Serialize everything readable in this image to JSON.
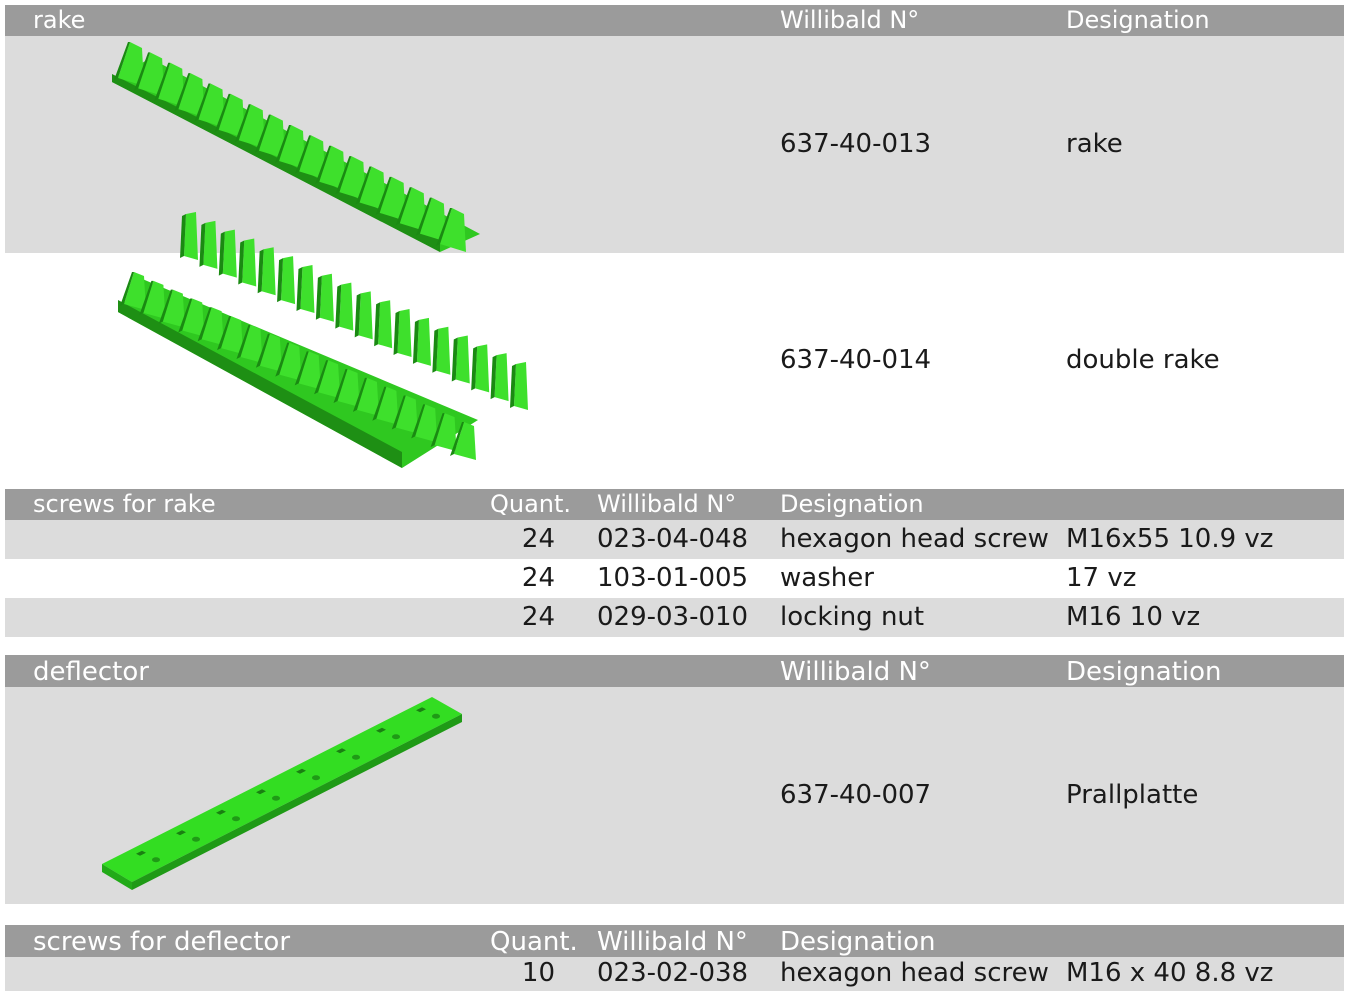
{
  "section1": {
    "title": "rake",
    "col_no": "Willibald N°",
    "col_desig": "Designation",
    "items": [
      {
        "number": "637-40-013",
        "designation": "rake"
      },
      {
        "number": "637-40-014",
        "designation": "double rake"
      }
    ]
  },
  "screws1": {
    "title": "screws for rake",
    "col_quant": "Quant.",
    "col_no": "Willibald N°",
    "col_desig": "Designation",
    "rows": [
      {
        "quant": "24",
        "number": "023-04-048",
        "designation": "hexagon head screw",
        "spec": "M16x55 10.9 vz"
      },
      {
        "quant": "24",
        "number": "103-01-005",
        "designation": "washer",
        "spec": "17 vz"
      },
      {
        "quant": "24",
        "number": "029-03-010",
        "designation": "locking nut",
        "spec": "M16 10 vz"
      }
    ]
  },
  "section2": {
    "title": "deflector",
    "col_no": "Willibald N°",
    "col_desig": "Designation",
    "items": [
      {
        "number": "637-40-007",
        "designation": "Prallplatte"
      }
    ]
  },
  "screws2": {
    "title": "screws for deflector",
    "col_quant": "Quant.",
    "col_no": "Willibald N°",
    "col_desig": "Designation",
    "rows": [
      {
        "quant": "10",
        "number": "023-02-038",
        "designation": "hexagon head screw",
        "spec": "M16 x 40 8.8 vz"
      }
    ]
  },
  "colors": {
    "header": "#9b9b9b",
    "band": "#dcdcdc",
    "part": "#33dd22"
  },
  "icons": [
    "rake-part-image",
    "double-rake-part-image",
    "deflector-part-image"
  ]
}
